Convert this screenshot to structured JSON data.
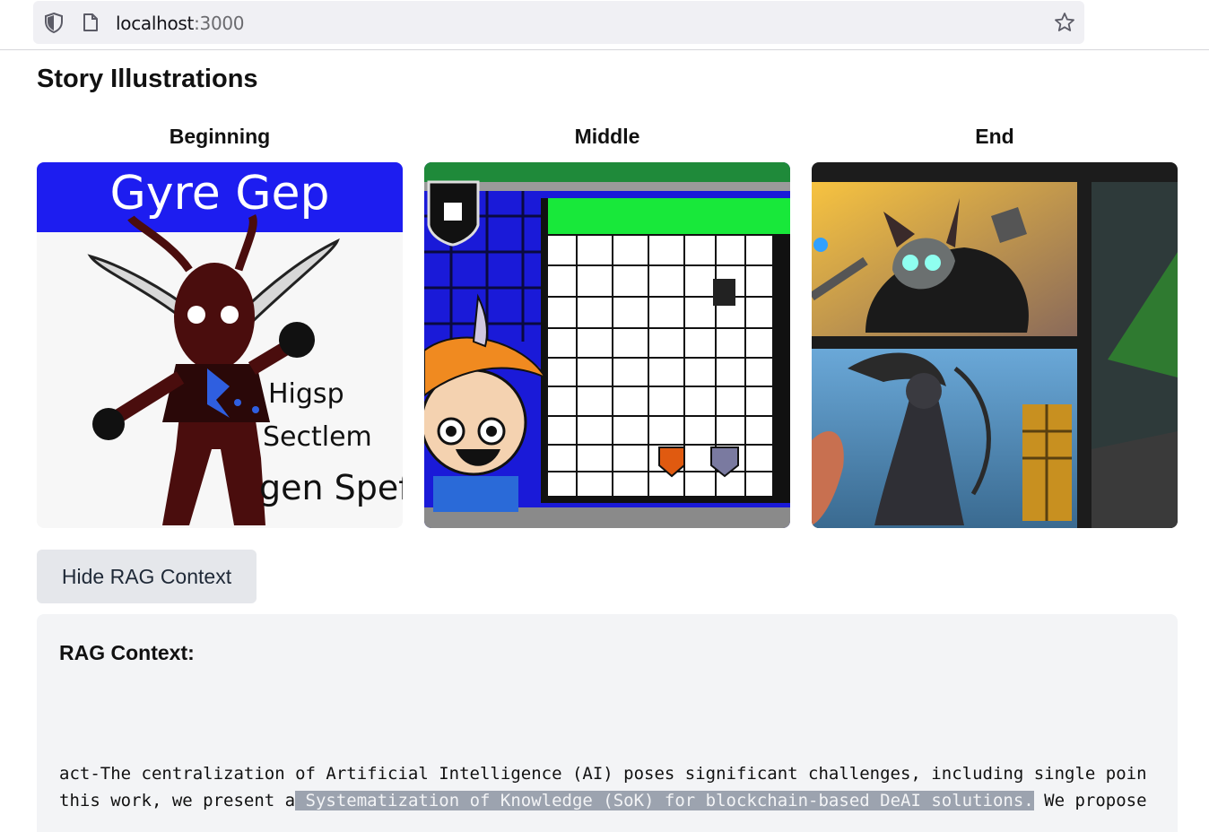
{
  "browser": {
    "url_host": "localhost",
    "url_port": ":3000"
  },
  "page": {
    "title": "Story Illustrations"
  },
  "illustrations": [
    {
      "label": "Beginning",
      "image_text": [
        "Gyre Gep",
        "Higsp",
        "Sectlem",
        "gen Spef"
      ]
    },
    {
      "label": "Middle"
    },
    {
      "label": "End"
    }
  ],
  "toggle_button": {
    "label": "Hide RAG Context"
  },
  "rag": {
    "title": "RAG Context:",
    "line1": "act-The centralization of Artificial Intelligence (AI) poses significant challenges, including single poin",
    "line2_pre": "this work, we present a",
    "line2_highlight": " Systematization of Knowledge (SoK) for blockchain-based DeAI solutions.",
    "line2_post": " We propose"
  },
  "colors": {
    "highlight": "#9ca3af",
    "button_bg": "#e5e7eb",
    "panel_bg": "#f3f4f6"
  }
}
